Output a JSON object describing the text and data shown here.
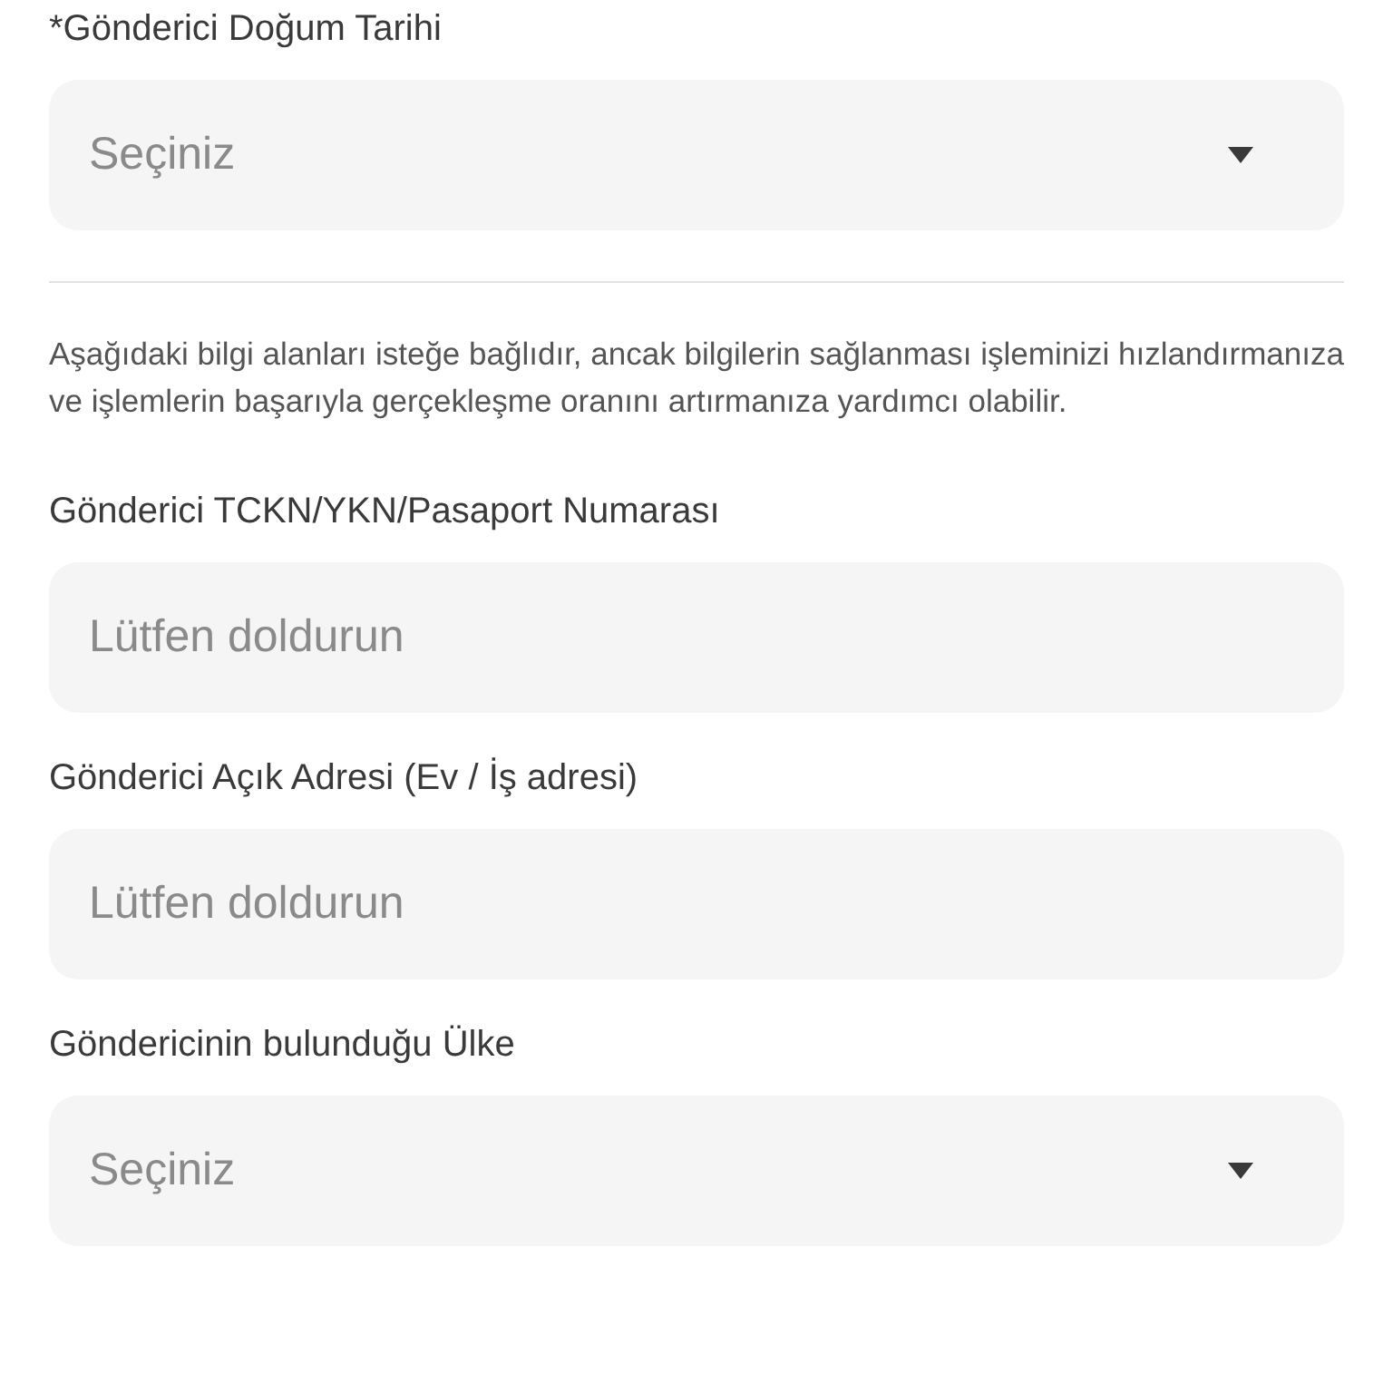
{
  "required_fields": [
    {
      "label": "*Gönderici Doğum Tarihi",
      "placeholder": "Seçiniz",
      "kind": "select"
    }
  ],
  "note": "Aşağıdaki bilgi alanları isteğe bağlıdır, ancak bilgilerin sağlanması işleminizi hızlandırmanıza ve işlemlerin başarıyla gerçekleşme oranını artırmanıza yardımcı olabilir.",
  "optional_fields": [
    {
      "label": "Gönderici TCKN/YKN/Pasaport Numarası",
      "placeholder": "Lütfen doldurun",
      "kind": "text"
    },
    {
      "label": "Gönderici Açık Adresi (Ev / İş adresi)",
      "placeholder": "Lütfen doldurun",
      "kind": "text"
    },
    {
      "label": "Göndericinin bulunduğu Ülke",
      "placeholder": "Seçiniz",
      "kind": "select"
    }
  ]
}
